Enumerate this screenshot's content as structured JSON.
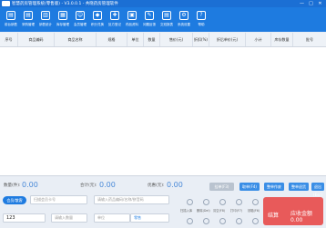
{
  "window": {
    "title": "智慧药房管理系统(零售版) - V3.0.0.1 - 共晓药房管理软件",
    "minimize": "—",
    "maximize": "□",
    "close": "✕"
  },
  "toolbar": [
    {
      "label": "前台销售",
      "icon": "cart-icon"
    },
    {
      "label": "采购管理",
      "icon": "purchase-icon"
    },
    {
      "label": "销售统计",
      "icon": "chart-icon"
    },
    {
      "label": "库存管理",
      "icon": "inventory-icon"
    },
    {
      "label": "会员管理",
      "icon": "member-icon"
    },
    {
      "label": "积分兑换",
      "icon": "gift-icon"
    },
    {
      "label": "处方登记",
      "icon": "prescription-icon"
    },
    {
      "label": "药品资料",
      "icon": "drug-icon"
    },
    {
      "label": "问题反馈",
      "icon": "feedback-icon"
    },
    {
      "label": "交班报表",
      "icon": "report-icon"
    },
    {
      "label": "系统设置",
      "icon": "settings-icon"
    },
    {
      "label": "帮助",
      "icon": "help-icon"
    }
  ],
  "grid": {
    "columns": [
      "序号",
      "商品编码",
      "商品名称",
      "规格",
      "单位",
      "数量",
      "售价(元)",
      "折扣(%)",
      "折后单价(元)",
      "小计",
      "库存数量",
      "批号"
    ]
  },
  "totals": {
    "count_label": "数量(件):",
    "count_value": "0.00",
    "total_label": "合计(元):",
    "total_value": "0.00",
    "discount_label": "优惠(元):",
    "discount_value": "0.00",
    "buttons": [
      "挂单(F3)",
      "取单(F4)",
      "整单作废",
      "整单退货",
      "退出(Esc)"
    ]
  },
  "member": {
    "tag": "会员/散客",
    "card_placeholder": "扫描会员卡号",
    "search_placeholder": "请输入药品编码/名称/拼音码",
    "qty_value": "123",
    "qty2_placeholder": "请输入数量",
    "unit_label": "单位",
    "mode_label": "零售",
    "actions": [
      "扫描入库",
      "删除(Del)",
      "清空(F8)",
      "打印(F7)",
      "钱箱(F6)"
    ]
  },
  "pay": {
    "key": "结算",
    "receivable_label": "应收金额",
    "receivable_value": "0.00"
  }
}
